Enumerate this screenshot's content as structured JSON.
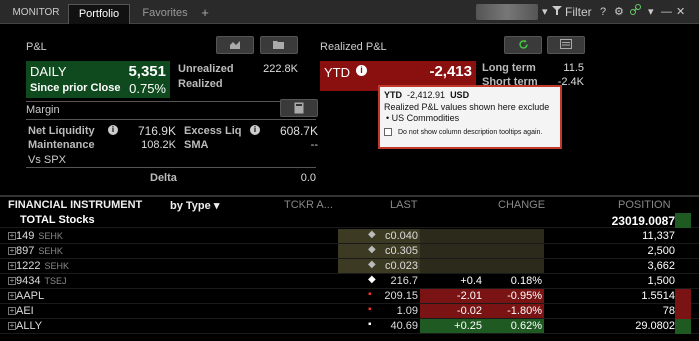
{
  "tabs": {
    "monitor": "MONITOR",
    "portfolio": "Portfolio",
    "favorites": "Favorites",
    "add": "+"
  },
  "toolbar": {
    "filter_label": "Filter",
    "help": "?"
  },
  "pnl": {
    "title": "P&L",
    "daily_label": "DAILY",
    "daily_value": "5,351",
    "since_label": "Since prior Close",
    "since_pct": "0.75%",
    "unrealized_label": "Unrealized",
    "unrealized_value": "222.8K",
    "realized_label": "Realized"
  },
  "realized": {
    "title": "Realized P&L",
    "ytd_label": "YTD",
    "ytd_value": "-2,413",
    "long_term_label": "Long term",
    "long_term_value": "11.5",
    "short_term_label": "Short term",
    "short_term_value": "-2.4K"
  },
  "tooltip": {
    "label": "YTD",
    "value": "-2,412.91",
    "currency": "USD",
    "message": "Realized P&L values shown here exclude",
    "bullet": "• US Commodities",
    "checkbox_label": "Do not show column description tooltips again."
  },
  "margin": {
    "title": "Margin",
    "net_liq_label": "Net Liquidity",
    "net_liq_value": "716.9K",
    "excess_liq_label": "Excess Liq",
    "excess_liq_value": "608.7K",
    "maintenance_label": "Maintenance",
    "maintenance_value": "108.2K",
    "sma_label": "SMA",
    "sma_value": "--",
    "vs_spx_label": "Vs SPX",
    "delta_label": "Delta",
    "delta_value": "0.0"
  },
  "table": {
    "headers": {
      "instrument": "FINANCIAL INSTRUMENT",
      "by_type": "by Type",
      "tckr": "TCKR A...",
      "last": "LAST",
      "change": "CHANGE",
      "position": "POSITION"
    },
    "total": {
      "label": "TOTAL Stocks",
      "position": "23019.0087"
    },
    "rows": [
      {
        "symbol": "149",
        "exch": "SEHK",
        "last": "c0.040",
        "chg": "",
        "pct": "",
        "position": "11,337"
      },
      {
        "symbol": "897",
        "exch": "SEHK",
        "last": "c0.305",
        "chg": "",
        "pct": "",
        "position": "2,500"
      },
      {
        "symbol": "1222",
        "exch": "SEHK",
        "last": "c0.023",
        "chg": "",
        "pct": "",
        "position": "3,662"
      },
      {
        "symbol": "9434",
        "exch": "TSEJ",
        "last": "216.7",
        "chg": "+0.4",
        "pct": "0.18%",
        "position": "1,500"
      },
      {
        "symbol": "AAPL",
        "exch": "",
        "last": "209.15",
        "chg": "-2.01",
        "pct": "-0.95%",
        "position": "1.5514"
      },
      {
        "symbol": "AEI",
        "exch": "",
        "last": "1.09",
        "chg": "-0.02",
        "pct": "-1.80%",
        "position": "78"
      },
      {
        "symbol": "ALLY",
        "exch": "",
        "last": "40.69",
        "chg": "+0.25",
        "pct": "0.62%",
        "position": "29.0802"
      }
    ]
  },
  "colors": {
    "green_box": "#0f4a1e",
    "red_box": "#8a1010",
    "olive": "#4a4a30",
    "red_cell": "#7a1414",
    "green_cell": "#1e5a22"
  }
}
